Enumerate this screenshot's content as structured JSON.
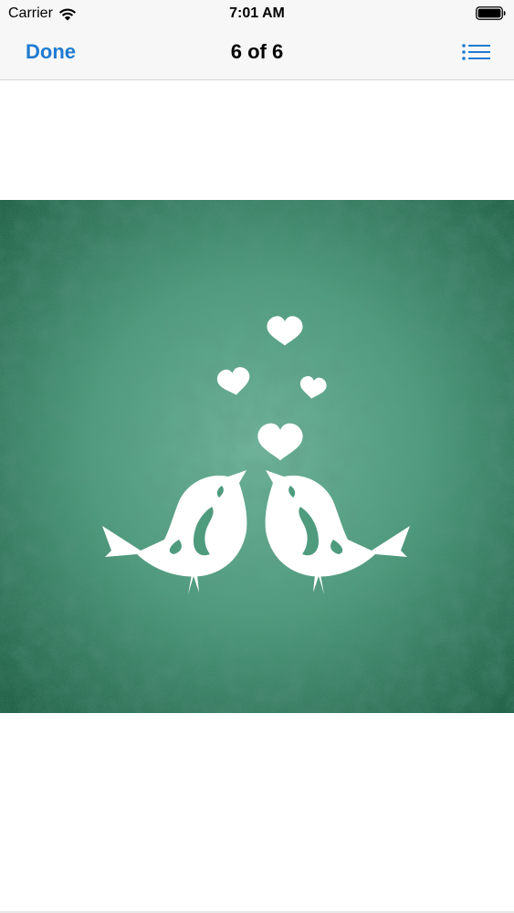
{
  "status_bar": {
    "carrier": "Carrier",
    "time": "7:01 AM",
    "wifi_icon": "wifi-icon",
    "battery_icon": "battery-icon"
  },
  "nav_bar": {
    "done_label": "Done",
    "title": "6 of 6",
    "list_icon": "list-icon"
  },
  "photo": {
    "description_icon": "love-birds-image",
    "background_color": "#4e9a7c",
    "accent_color": "#ffffff"
  },
  "colors": {
    "tint": "#1e7bd0",
    "bar_background": "#f7f7f8"
  }
}
